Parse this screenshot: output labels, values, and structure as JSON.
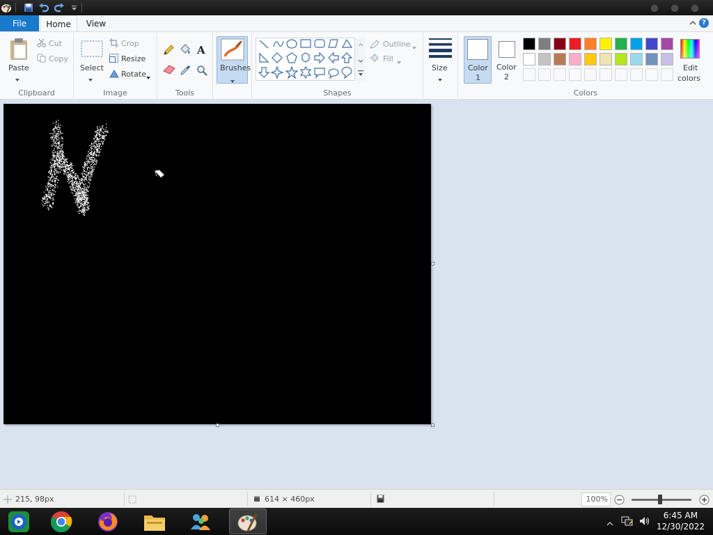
{
  "ribbon": {
    "tabs": {
      "file": "File",
      "home": "Home",
      "view": "View"
    },
    "clipboard": {
      "label": "Clipboard",
      "paste": "Paste",
      "cut": "Cut",
      "copy": "Copy"
    },
    "image": {
      "label": "Image",
      "select": "Select",
      "crop": "Crop",
      "resize": "Resize",
      "rotate": "Rotate"
    },
    "tools": {
      "label": "Tools"
    },
    "brushes": {
      "label": "Brushes"
    },
    "shapes": {
      "label": "Shapes",
      "outline": "Outline",
      "fill": "Fill"
    },
    "size": {
      "label": "Size"
    },
    "colors": {
      "label": "Colors",
      "color1_line1": "Color",
      "color1_line2": "1",
      "color2_line1": "Color",
      "color2_line2": "2",
      "edit_line1": "Edit",
      "edit_line2": "colors",
      "palette_row1": [
        "#000000",
        "#7f7f7f",
        "#880015",
        "#ed1c24",
        "#ff7f27",
        "#fff200",
        "#22b14c",
        "#00a2e8",
        "#3f48cc",
        "#a349a4"
      ],
      "palette_row2": [
        "#ffffff",
        "#c3c3c3",
        "#b97a57",
        "#ffaec9",
        "#ffc90e",
        "#efe4b0",
        "#b5e61d",
        "#99d9ea",
        "#7092be",
        "#c8bfe7"
      ],
      "color1": "#ffffff",
      "color2": "#ffffff"
    }
  },
  "status": {
    "cursor_position": "215, 98px",
    "canvas_size": "614 × 460px",
    "zoom": "100%"
  },
  "taskbar": {
    "time": "6:45 AM",
    "date": "12/30/2022",
    "apps": [
      "media-center-icon",
      "chrome-icon",
      "firefox-icon",
      "file-explorer-icon",
      "network-people-icon",
      "paint-icon"
    ]
  },
  "canvas": {
    "background": "#000000"
  }
}
